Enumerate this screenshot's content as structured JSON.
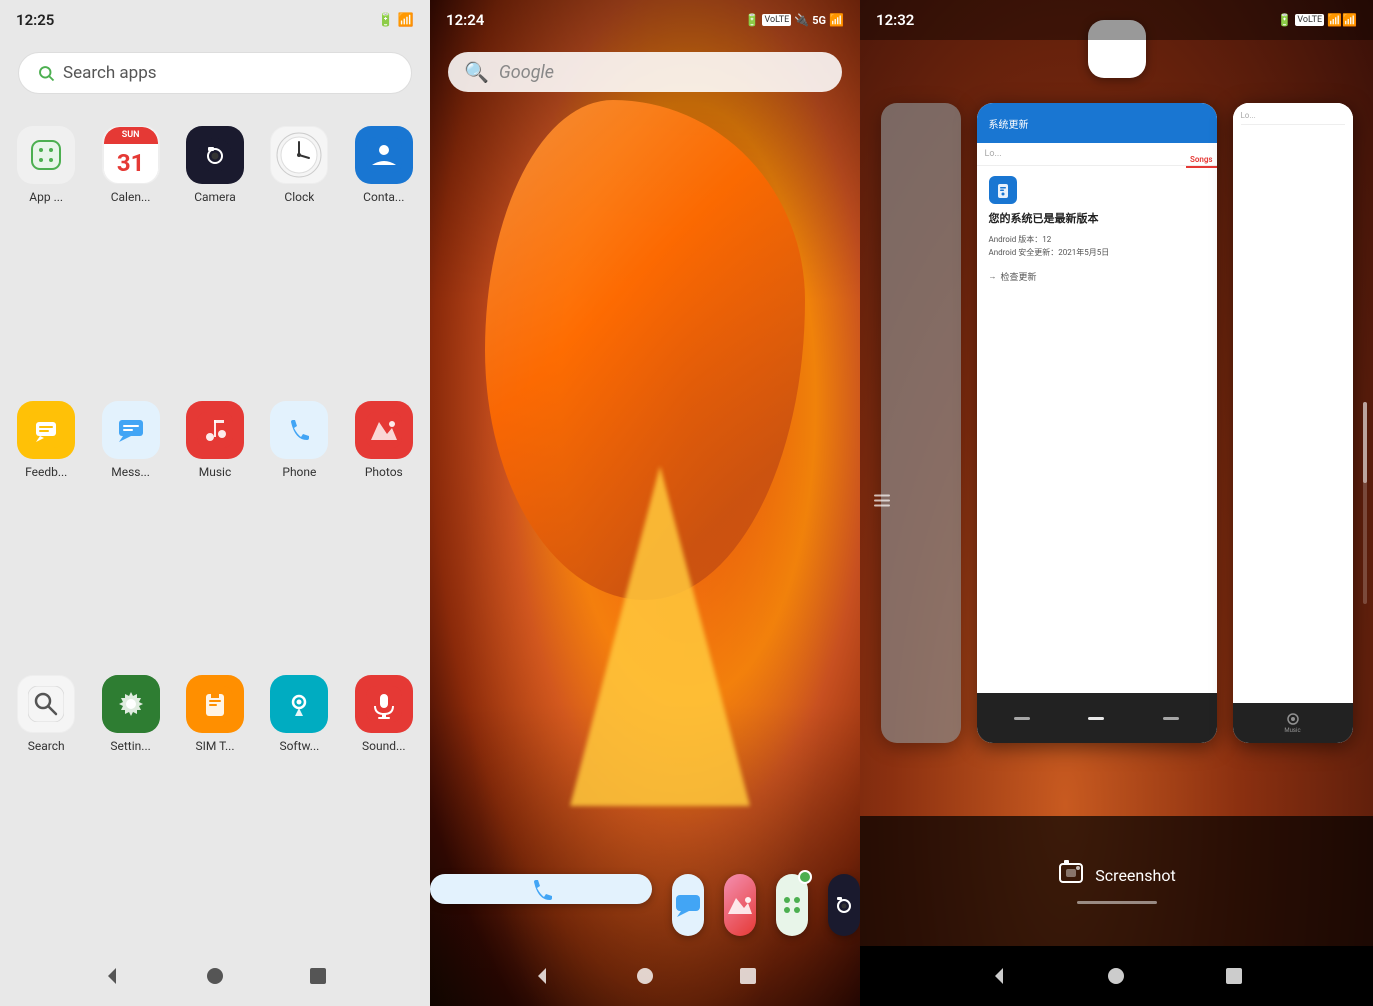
{
  "panel1": {
    "statusBar": {
      "time": "12:25",
      "battery": "█",
      "signal": "↗█"
    },
    "searchBar": {
      "placeholder": "Search apps"
    },
    "apps": [
      {
        "id": "appstore",
        "label": "App ...",
        "iconColor": "#f0f0f0",
        "iconType": "appstore"
      },
      {
        "id": "calendar",
        "label": "Calen...",
        "iconColor": "#fff",
        "iconType": "calendar"
      },
      {
        "id": "camera",
        "label": "Camera",
        "iconColor": "#1a1a2e",
        "iconType": "camera"
      },
      {
        "id": "clock",
        "label": "Clock",
        "iconColor": "#f5f5f5",
        "iconType": "clock"
      },
      {
        "id": "contacts",
        "label": "Conta...",
        "iconColor": "#1976d2",
        "iconType": "contacts"
      },
      {
        "id": "feedback",
        "label": "Feedb...",
        "iconColor": "#ffc107",
        "iconType": "feedback"
      },
      {
        "id": "messages",
        "label": "Mess...",
        "iconColor": "#e3f2fd",
        "iconType": "messages"
      },
      {
        "id": "music",
        "label": "Music",
        "iconColor": "#e53935",
        "iconType": "music"
      },
      {
        "id": "phone",
        "label": "Phone",
        "iconColor": "#e3f2fd",
        "iconType": "phone"
      },
      {
        "id": "photos",
        "label": "Photos",
        "iconColor": "#e53935",
        "iconType": "photos"
      },
      {
        "id": "search",
        "label": "Search",
        "iconColor": "#f5f5f5",
        "iconType": "search"
      },
      {
        "id": "settings",
        "label": "Settin...",
        "iconColor": "#2e7d32",
        "iconType": "settings"
      },
      {
        "id": "simt",
        "label": "SIM T...",
        "iconColor": "#ff8f00",
        "iconType": "simt"
      },
      {
        "id": "softw",
        "label": "Softw...",
        "iconColor": "#00acc1",
        "iconType": "softw"
      },
      {
        "id": "sound",
        "label": "Sound...",
        "iconColor": "#e53935",
        "iconType": "sound"
      }
    ],
    "navBar": {
      "backIcon": "◁",
      "homeIcon": "●",
      "recentIcon": "■"
    }
  },
  "panel2": {
    "statusBar": {
      "time": "12:24",
      "batteryIcon": "■",
      "signalText": "* 5G ↗█"
    },
    "searchBar": {
      "placeholder": "Google"
    },
    "dockApps": [
      {
        "id": "phone",
        "iconType": "phone"
      },
      {
        "id": "messages",
        "iconType": "messages"
      },
      {
        "id": "photos",
        "iconType": "photos"
      },
      {
        "id": "appstore",
        "iconType": "appstore",
        "badge": true
      },
      {
        "id": "camera",
        "iconType": "camera"
      }
    ],
    "navBar": {
      "backIcon": "◁",
      "homeIcon": "●",
      "recentIcon": "■"
    }
  },
  "panel3": {
    "statusBar": {
      "time": "12:32",
      "batteryIcon": "■",
      "signalText": "▲▲█"
    },
    "systemUpdate": {
      "title": "您的系统已是最新版本",
      "androidVersion": "Android 版本：12",
      "securityUpdate": "Android 安全更新：2021年5月5日",
      "checkUpdate": "检查更新"
    },
    "songsTab": "Songs",
    "searchPlaceholder": "Lo...",
    "screenshot": {
      "label": "Screenshot"
    },
    "navBar": {
      "backIcon": "◁",
      "homeIcon": "●",
      "recentIcon": "■"
    }
  }
}
